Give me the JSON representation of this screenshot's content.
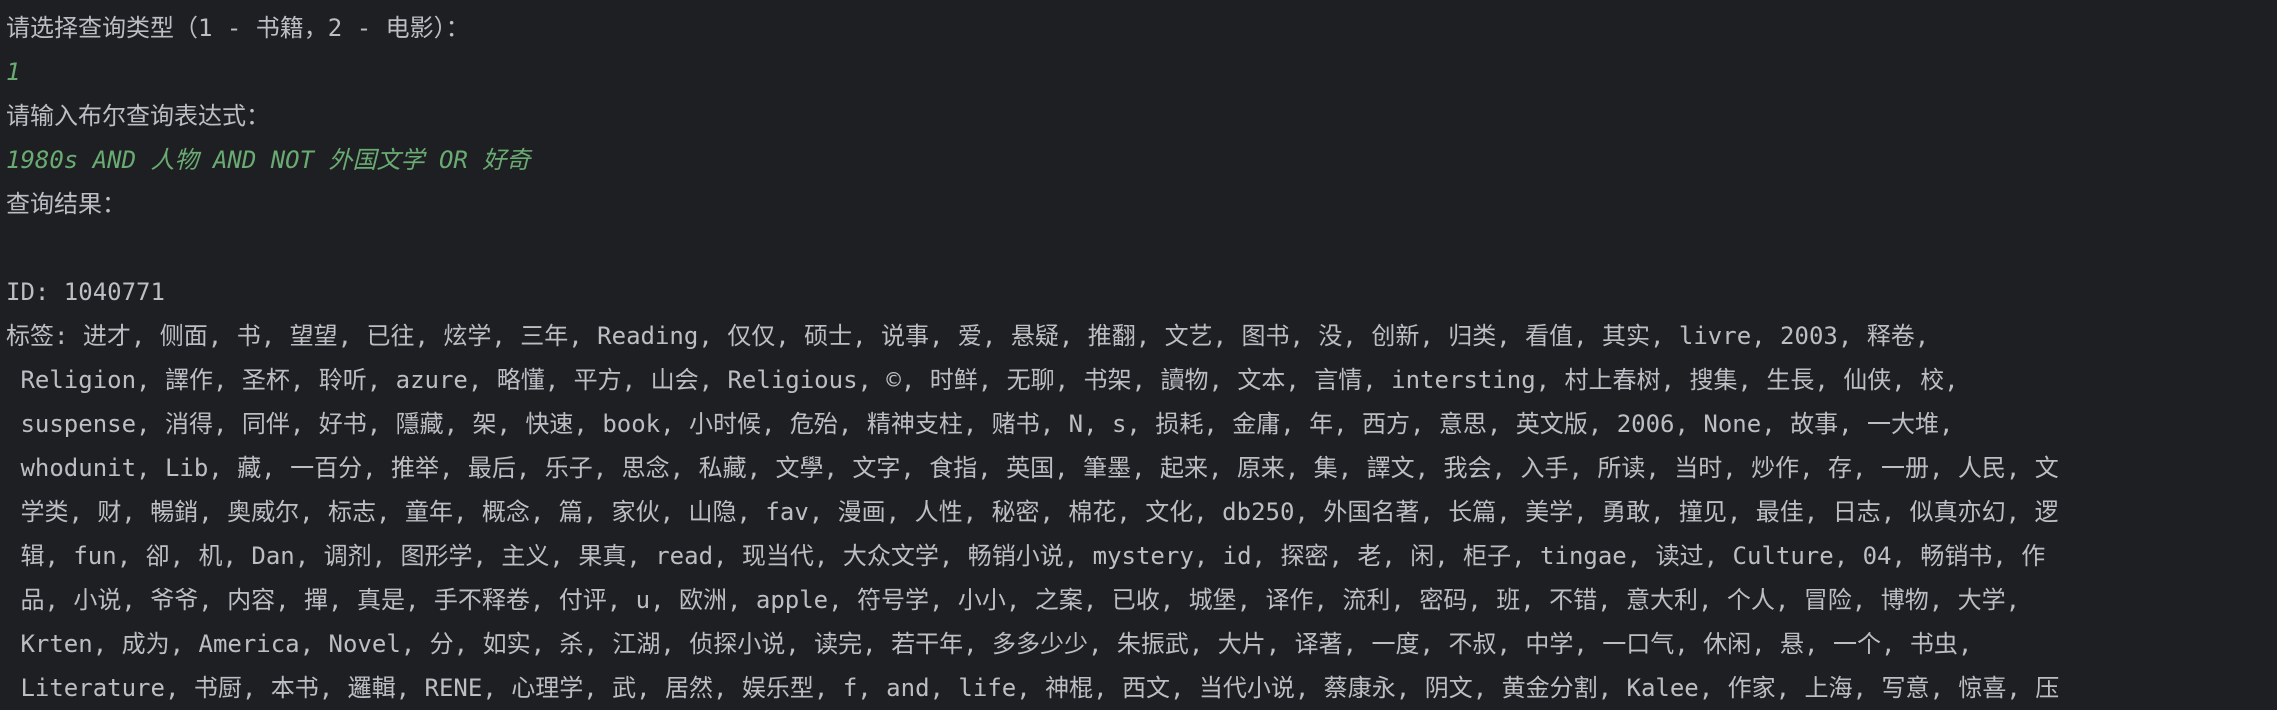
{
  "console": {
    "prompt_type": "请选择查询类型（1 - 书籍，2 - 电影）：",
    "input_type": "1",
    "prompt_expr": "请输入布尔查询表达式：",
    "input_expr": "1980s AND 人物 AND NOT 外国文学 OR 好奇",
    "result_header": "查询结果：",
    "result_id": "ID: 1040771",
    "tag_lines": [
      "标签: 进才, 侧面, 书, 望望, 已往, 炫学, 三年, Reading, 仅仅, 硕士, 说事, 爱, 悬疑, 推翻, 文艺, 图书, 没, 创新, 归类, 看值, 其实, livre, 2003, 释卷,",
      " Religion, 譯作, 圣杯, 聆听, azure, 略懂, 平方, 山会, Religious, ©, 时鲜, 无聊, 书架, 讀物, 文本, 言情, intersting, 村上春树, 搜集, 生長, 仙侠, 校,",
      " suspense, 消得, 同伴, 好书, 隱藏, 架, 快速, book, 小时候, 危殆, 精神支柱, 赌书, N, s, 损耗, 金庸, 年, 西方, 意思, 英文版, 2006, None, 故事, 一大堆,",
      " whodunit, Lib, 藏, 一百分, 推举, 最后, 乐子, 思念, 私藏, 文學, 文字, 食指, 英国, 筆墨, 起来, 原来, 集, 譯文, 我会, 入手, 所读, 当时, 炒作, 存, 一册, 人民, 文",
      " 学类, 财, 暢銷, 奥威尔, 标志, 童年, 概念, 篇, 家伙, 山隐, fav, 漫画, 人性, 秘密, 棉花, 文化, db250, 外国名著, 长篇, 美学, 勇敢, 撞见, 最佳, 日志, 似真亦幻, 逻",
      " 辑, fun, 卻, 机, Dan, 调剂, 图形学, 主义, 果真, read, 现当代, 大众文学, 畅销小说, mystery, id, 探密, 老, 闲, 柜子, tingae, 读过, Culture, 04, 畅销书, 作",
      " 品, 小说, 爷爷, 内容, 撣, 真是, 手不释卷, 付评, u, 欧洲, apple, 符号学, 小小, 之案, 已收, 城堡, 译作, 流利, 密码, 班, 不错, 意大利, 个人, 冒险, 博物, 大学,",
      " Krten, 成为, America, Novel, 分, 如实, 杀, 江湖, 侦探小说, 读完, 若干年, 多多少少, 朱振武, 大片, 译著, 一度, 不叔, 中学, 一口气, 休闲, 悬, 一个, 书虫,",
      " Literature, 书厨, 本书, 邏輯, RENE, 心理学, 武, 居然, 娱乐型, f, and, life, 神棍, 西文, 当代小说, 蔡康永, 阴文, 黄金分割, Kalee, 作家, 上海, 写意, 惊喜, 压"
    ]
  }
}
